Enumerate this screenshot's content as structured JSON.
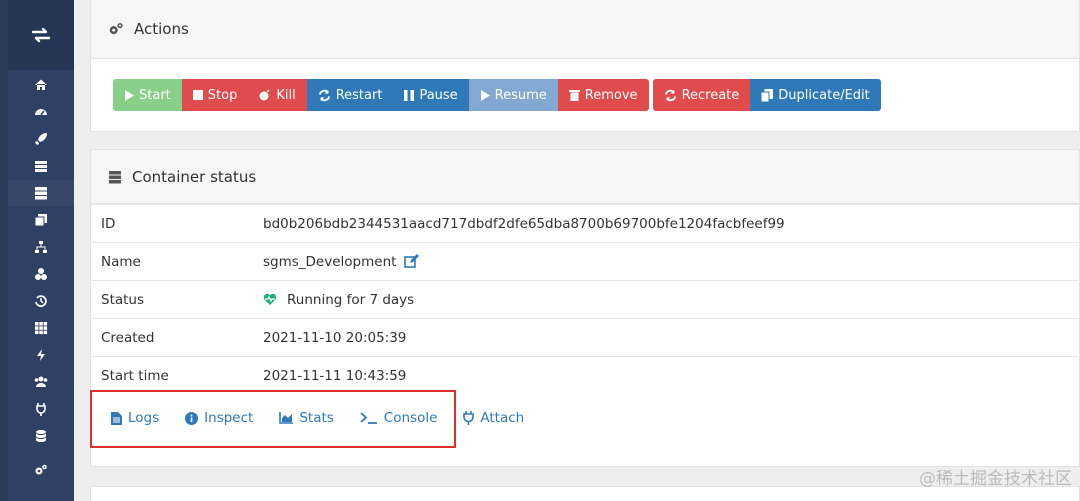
{
  "sidebar": {
    "brand_icon": "swap-arrows-icon",
    "items": [
      "home-icon",
      "dashboard-icon",
      "rocket-icon",
      "list-icon",
      "server-icon",
      "clone-icon",
      "sitemap-icon",
      "cubes-icon",
      "history-icon",
      "grid-icon",
      "bolt-icon",
      "users-icon",
      "plug-icon",
      "database-icon",
      "cogs-icon"
    ]
  },
  "actions": {
    "title": "Actions",
    "buttons": {
      "start": "Start",
      "stop": "Stop",
      "kill": "Kill",
      "restart": "Restart",
      "pause": "Pause",
      "resume": "Resume",
      "remove": "Remove",
      "recreate": "Recreate",
      "duplicate": "Duplicate/Edit"
    }
  },
  "container_status": {
    "title": "Container status",
    "rows": {
      "id_label": "ID",
      "id_value": "bd0b206bdb2344531aacd717dbdf2dfe65dba8700b69700bfe1204facbfeef99",
      "name_label": "Name",
      "name_value": "sgms_Development",
      "status_label": "Status",
      "status_value": "Running for 7 days",
      "created_label": "Created",
      "created_value": "2021-11-10 20:05:39",
      "start_label": "Start time",
      "start_value": "2021-11-11 10:43:59"
    },
    "links": {
      "logs": "Logs",
      "inspect": "Inspect",
      "stats": "Stats",
      "console": "Console",
      "attach": "Attach"
    }
  },
  "watermark": "@稀土掘金技术社区",
  "colors": {
    "sidebar": "#2e4063",
    "primary": "#2f79b9",
    "danger": "#e04b4b",
    "success": "#88cf8a",
    "status_ok": "#1fae7b"
  }
}
